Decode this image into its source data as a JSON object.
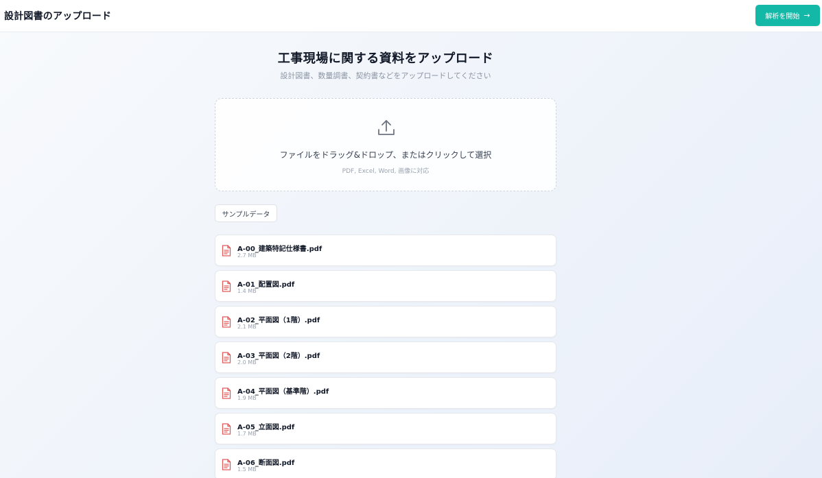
{
  "header": {
    "title": "設計図書のアップロード",
    "start_button": "解析を開始",
    "start_arrow": "→"
  },
  "main": {
    "title": "工事現場に関する資料をアップロード",
    "subtitle": "設計図書、数量調書、契約書などをアップロードしてください"
  },
  "dropzone": {
    "icon": "upload-icon",
    "text": "ファイルをドラッグ&ドロップ、またはクリックして選択",
    "hint": "PDF, Excel, Word, 画像に対応"
  },
  "sample_button": "サンプルデータ",
  "files": [
    {
      "name": "A-00_建築特記仕様書.pdf",
      "size": "2.7 MB"
    },
    {
      "name": "A-01_配置図.pdf",
      "size": "1.4 MB"
    },
    {
      "name": "A-02_平面図（1階）.pdf",
      "size": "2.1 MB"
    },
    {
      "name": "A-03_平面図（2階）.pdf",
      "size": "2.0 MB"
    },
    {
      "name": "A-04_平面図（基準階）.pdf",
      "size": "1.9 MB"
    },
    {
      "name": "A-05_立面図.pdf",
      "size": "1.7 MB"
    },
    {
      "name": "A-06_断面図.pdf",
      "size": "1.5 MB"
    }
  ],
  "colors": {
    "accent": "#14b8a6",
    "file_icon": "#e05a5a",
    "upload_icon": "#6b7280"
  }
}
